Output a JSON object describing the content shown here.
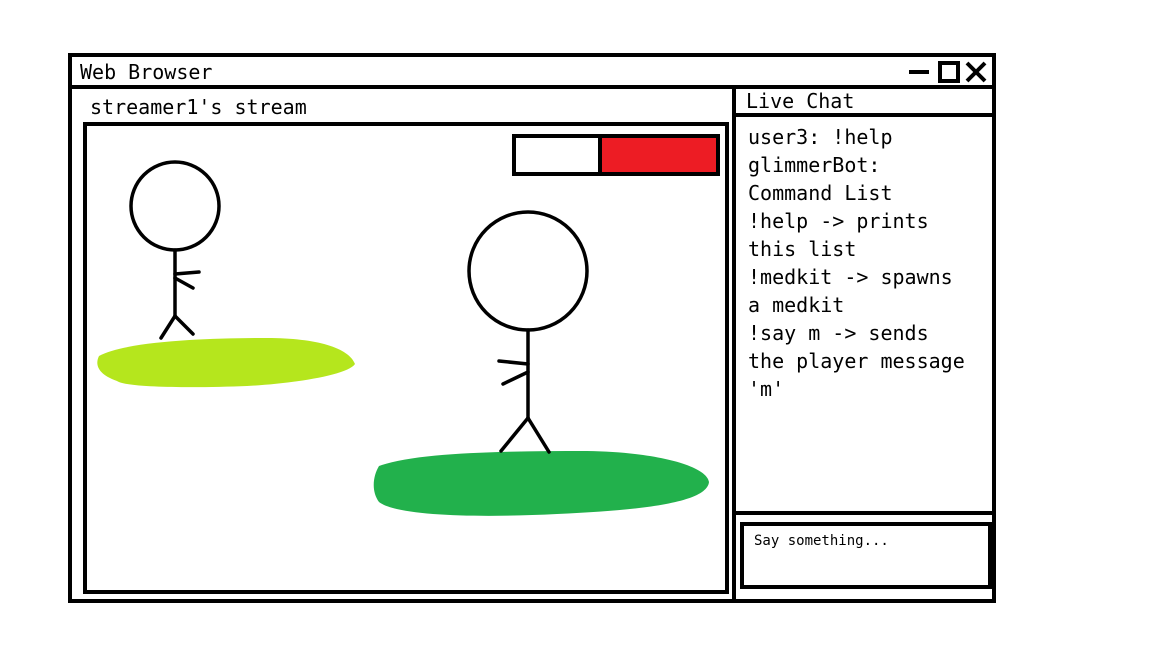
{
  "window": {
    "title": "Web Browser",
    "controls": [
      "minimize-icon",
      "maximize-icon",
      "close-icon"
    ]
  },
  "stream": {
    "title": "streamer1's stream",
    "health_bar": {
      "filled_fraction": 0.57,
      "fill_color": "#ed1c24"
    },
    "platform_colors": {
      "light": "#b5e61d",
      "dark": "#22b14c"
    }
  },
  "chat": {
    "title": "Live Chat",
    "lines": [
      "user3: !help",
      "glimmerBot:",
      "Command List",
      "!help -> prints",
      "this list",
      "!medkit -> spawns",
      "a medkit",
      "!say m -> sends",
      "the player message",
      "'m'"
    ],
    "input_placeholder": "Say something..."
  }
}
